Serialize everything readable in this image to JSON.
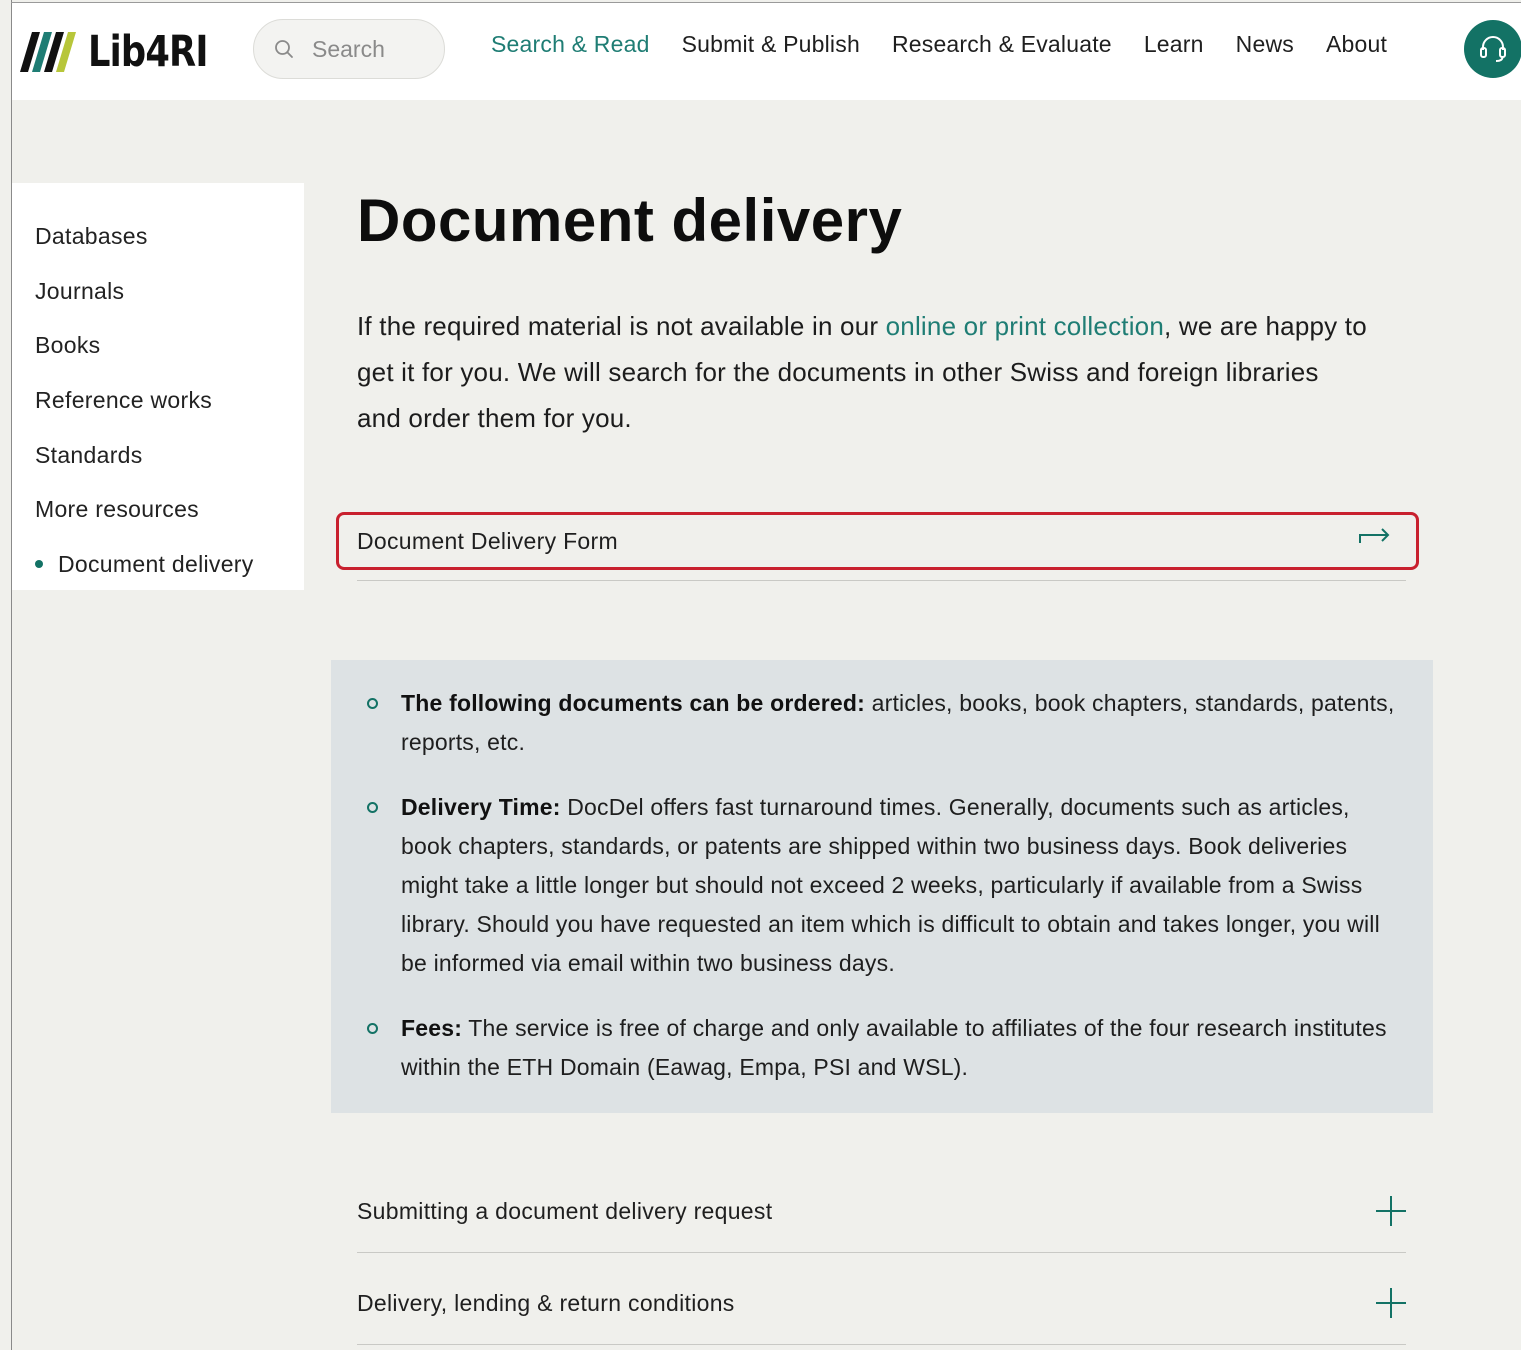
{
  "header": {
    "logo_text": "Lib4RI",
    "search": {
      "placeholder": "Search",
      "value": ""
    },
    "nav": [
      {
        "label": "Search & Read",
        "active": true
      },
      {
        "label": "Submit & Publish",
        "active": false
      },
      {
        "label": "Research & Evaluate",
        "active": false
      },
      {
        "label": "Learn",
        "active": false
      },
      {
        "label": "News",
        "active": false
      },
      {
        "label": "About",
        "active": false
      }
    ],
    "help_icon": "headset-icon"
  },
  "sidebar": {
    "items": [
      {
        "label": "Databases"
      },
      {
        "label": "Journals"
      },
      {
        "label": "Books"
      },
      {
        "label": "Reference works"
      },
      {
        "label": "Standards"
      },
      {
        "label": "More resources"
      },
      {
        "label": "Document delivery",
        "current": true
      }
    ]
  },
  "main": {
    "title": "Document delivery",
    "intro": {
      "before_link": "If the required material is not available in our ",
      "link": "online or print collection",
      "after_link": ", we are happy to get it for you. We will search for the documents in other Swiss and foreign libraries and order them for you."
    },
    "form_link": {
      "label": "Document Delivery Form",
      "icon": "arrow-right-icon"
    },
    "info": [
      {
        "heading": "The following documents can be ordered:",
        "text": " articles, books, book chapters, standards, patents, reports, etc."
      },
      {
        "heading": "Delivery Time:",
        "text": " DocDel offers fast turnaround times. Generally, documents such as articles, book chapters, standards, or patents are shipped within two business days. Book deliveries might take a little longer but should not exceed 2 weeks, particularly if available from a Swiss library. Should you have requested an item which is difficult to obtain and takes longer, you will be informed via email within two business days."
      },
      {
        "heading": "Fees:",
        "text": " The service is free of charge and only available to affiliates of the four research institutes within the ETH Domain (Eawag, Empa, PSI and WSL)."
      }
    ],
    "accordions": [
      {
        "label": "Submitting a document delivery request",
        "icon": "plus-icon"
      },
      {
        "label": "Delivery, lending & return conditions",
        "icon": "plus-icon"
      }
    ]
  },
  "colors": {
    "accent": "#137265",
    "link": "#1f7d74",
    "highlight": "#c8202e",
    "background": "#f0f0ec",
    "info_box": "#dde2e4"
  }
}
